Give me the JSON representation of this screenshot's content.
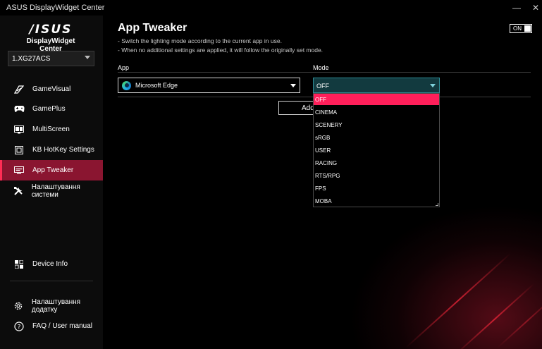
{
  "window": {
    "title": "ASUS DisplayWidget Center",
    "minimize_glyph": "—",
    "close_glyph": "✕"
  },
  "sidebar": {
    "logo_mark": "/ISUS",
    "logo_sub": "DisplayWidget Center",
    "device": "1.XG27ACS",
    "items": [
      {
        "label": "GameVisual",
        "icon": "gamevisual-icon"
      },
      {
        "label": "GamePlus",
        "icon": "gamepad-icon"
      },
      {
        "label": "MultiScreen",
        "icon": "multiscreen-icon"
      },
      {
        "label": "KB HotKey Settings",
        "icon": "keyboard-icon"
      },
      {
        "label": "App Tweaker",
        "icon": "app-tweaker-icon",
        "active": true
      },
      {
        "label": "Налаштування системи",
        "icon": "tools-icon"
      }
    ],
    "device_info": "Device Info",
    "app_settings": "Налаштування додатку",
    "faq": "FAQ / User manual"
  },
  "main": {
    "title": "App Tweaker",
    "desc1": "- Switch the lighting mode according to the current app in use.",
    "desc2": "- When no additional settings are applied, it will follow the originally set mode.",
    "toggle_label": "ON",
    "app_header": "App",
    "mode_header": "Mode",
    "app_value": "Microsoft Edge",
    "add_button": "Add",
    "mode_value": "OFF",
    "mode_options": [
      "OFF",
      "CINEMA",
      "SCENERY",
      "sRGB",
      "USER",
      "RACING",
      "RTS/RPG",
      "FPS",
      "MOBA"
    ]
  },
  "colors": {
    "accent": "#ff1f5a",
    "active_nav": "#8a1530",
    "mode_select_bg": "#123a3f"
  }
}
